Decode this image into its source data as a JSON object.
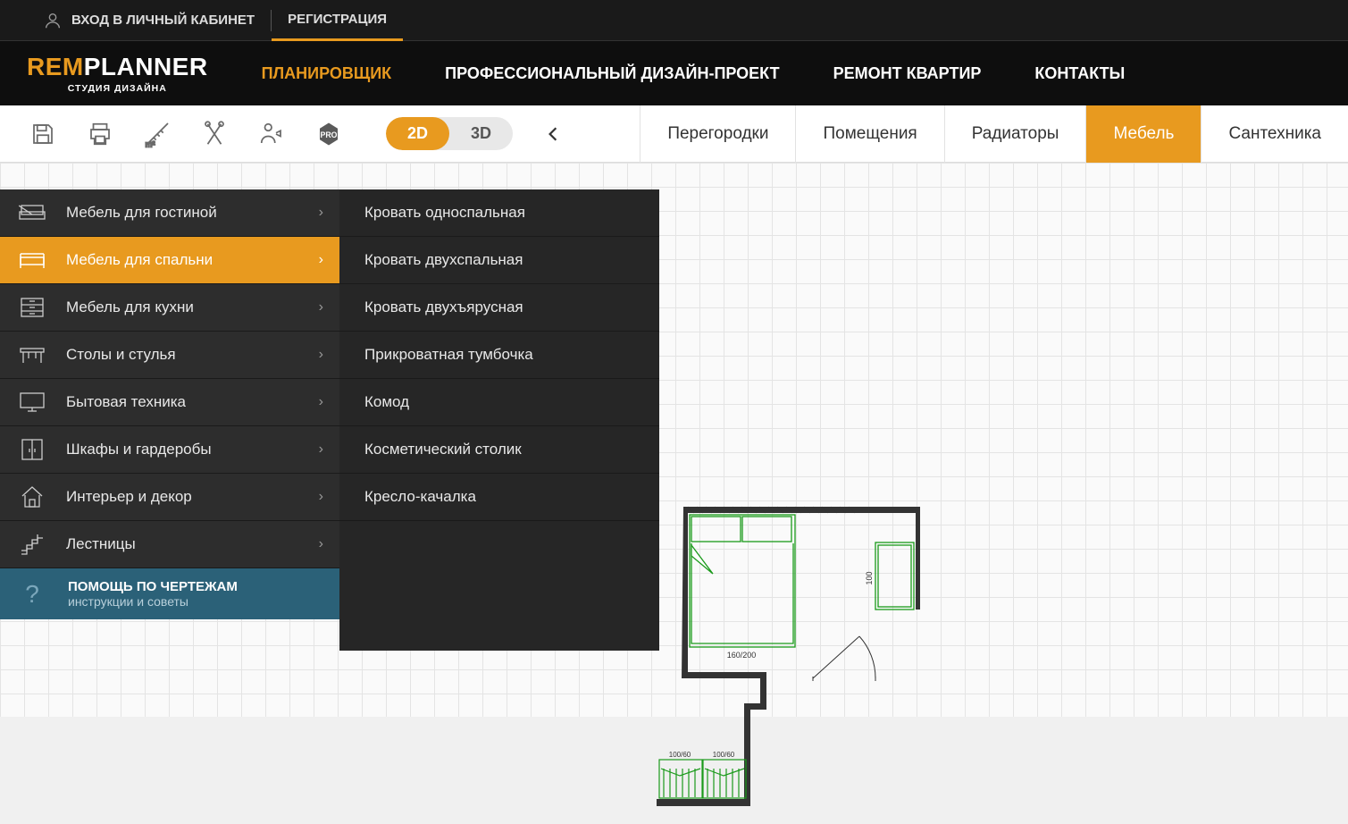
{
  "topbar": {
    "login": "ВХОД В ЛИЧНЫЙ КАБИНЕТ",
    "register": "РЕГИСТРАЦИЯ"
  },
  "logo": {
    "rem": "REM",
    "planner": "PLANNER",
    "tagline": "СТУДИЯ ДИЗАЙНА"
  },
  "nav": {
    "planner": "ПЛАНИРОВЩИК",
    "design": "ПРОФЕССИОНАЛЬНЫЙ ДИЗАЙН-ПРОЕКТ",
    "renovation": "РЕМОНТ КВАРТИР",
    "contacts": "КОНТАКТЫ"
  },
  "view": {
    "2d": "2D",
    "3d": "3D"
  },
  "tabs": {
    "partitions": "Перегородки",
    "rooms": "Помещения",
    "radiators": "Радиаторы",
    "furniture": "Мебель",
    "plumbing": "Сантехника"
  },
  "categories": [
    {
      "label": "Мебель для гостиной"
    },
    {
      "label": "Мебель для спальни"
    },
    {
      "label": "Мебель для кухни"
    },
    {
      "label": "Столы и стулья"
    },
    {
      "label": "Бытовая техника"
    },
    {
      "label": "Шкафы и гардеробы"
    },
    {
      "label": "Интерьер и декор"
    },
    {
      "label": "Лестницы"
    }
  ],
  "help": {
    "title": "ПОМОЩЬ ПО ЧЕРТЕЖАМ",
    "sub": "инструкции и советы"
  },
  "submenu": [
    "Кровать односпальная",
    "Кровать двухспальная",
    "Кровать двухъярусная",
    "Прикроватная тумбочка",
    "Комод",
    "Косметический столик",
    "Кресло-качалка"
  ],
  "plan": {
    "bed_dim": "160/200",
    "closet_dim": "100",
    "wardrobe_dims": [
      "100/60",
      "100/60"
    ]
  }
}
